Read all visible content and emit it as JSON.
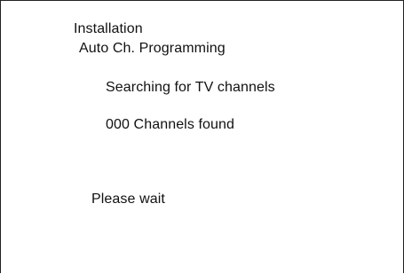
{
  "menu": {
    "title": "Installation",
    "subtitle": "Auto Ch. Programming"
  },
  "search": {
    "status": "Searching for TV channels",
    "channels_found": "000 Channels found"
  },
  "footer": {
    "message": "Please wait"
  },
  "colors": {
    "background": "#ffffff",
    "text": "#111111",
    "frame": "#222222"
  }
}
